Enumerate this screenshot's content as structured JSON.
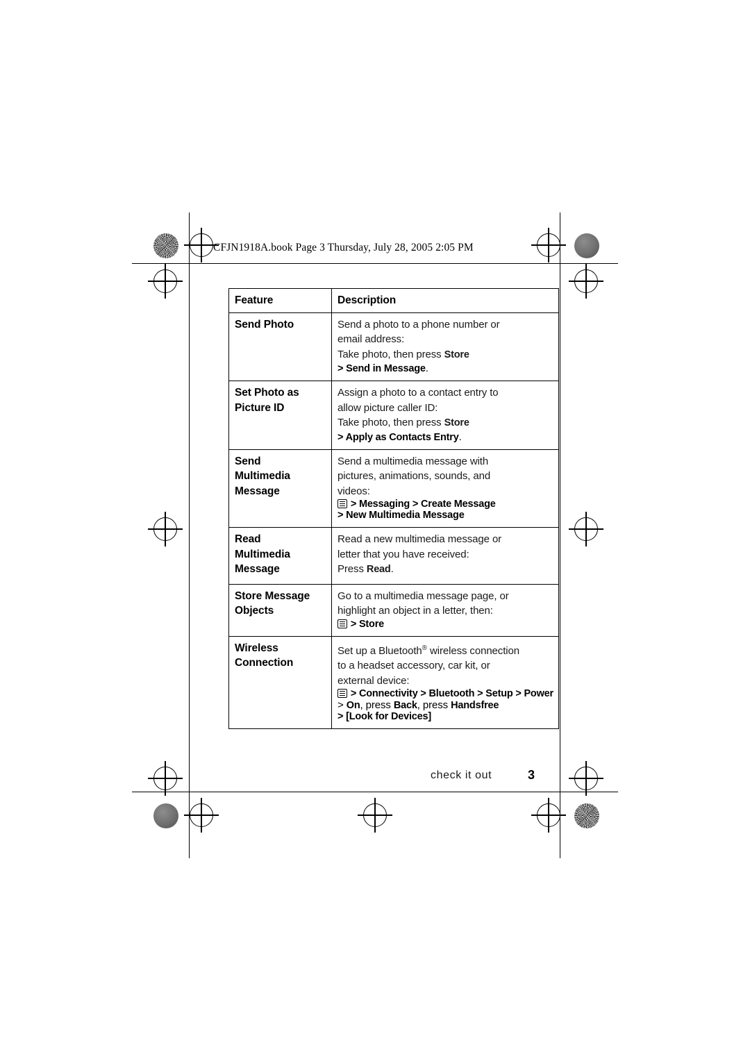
{
  "header": {
    "file_line": "CFJN1918A.book  Page 3  Thursday, July 28, 2005  2:05 PM"
  },
  "table": {
    "columns": [
      "Feature",
      "Description"
    ],
    "rows": [
      {
        "feature": "Send Photo",
        "lines": [
          "Send a photo to a phone number or",
          "email address:"
        ],
        "press_line_prefix": "Take photo, then press ",
        "press_line_key": "Store",
        "path_parts": [
          ">",
          "Send in Message",
          "."
        ]
      },
      {
        "feature_line1": "Set Photo as",
        "feature_line2": "Picture ID",
        "lines": [
          "Assign a photo to a contact entry to",
          "allow picture caller ID:"
        ],
        "press_line_prefix": "Take photo, then press ",
        "press_line_key": "Store",
        "path_parts": [
          ">",
          "Apply as Contacts Entry",
          "."
        ]
      },
      {
        "feature_line1": "Send",
        "feature_line2": "Multimedia",
        "feature_line3": "Message",
        "lines": [
          "Send a multimedia message with",
          "pictures, animations, sounds, and",
          "videos:"
        ],
        "menu_icon": "menu-key-icon",
        "path_line1": "> Messaging > Create Message",
        "path_line2": "> New Multimedia Message"
      },
      {
        "feature_line1": "Read",
        "feature_line2": "Multimedia",
        "feature_line3": "Message",
        "lines": [
          "Read a new multimedia message or",
          "letter that you have received:"
        ],
        "press_line_prefix": "Press ",
        "press_line_key": "Read",
        "press_line_suffix": "."
      },
      {
        "feature_line1": "Store Message",
        "feature_line2": "Objects",
        "lines": [
          "Go to a multimedia message page, or",
          "highlight an object in a letter, then:"
        ],
        "menu_icon": "menu-key-icon",
        "path_line1": "> Store"
      },
      {
        "feature_line1": "Wireless",
        "feature_line2": "Connection",
        "lines": [
          "Set up a Bluetooth® wireless connection",
          "to a headset accessory, car kit, or",
          "external device:"
        ],
        "menu_icon": "menu-key-icon",
        "path_line1": "> Connectivity > Bluetooth > Setup > Power",
        "path_line2_parts": [
          "> ",
          "On",
          ", press ",
          "Back",
          ", press ",
          "Handsfree"
        ],
        "path_line3": "> [Look for Devices]"
      }
    ]
  },
  "footer": {
    "label": "check it out",
    "page_number": "3"
  }
}
